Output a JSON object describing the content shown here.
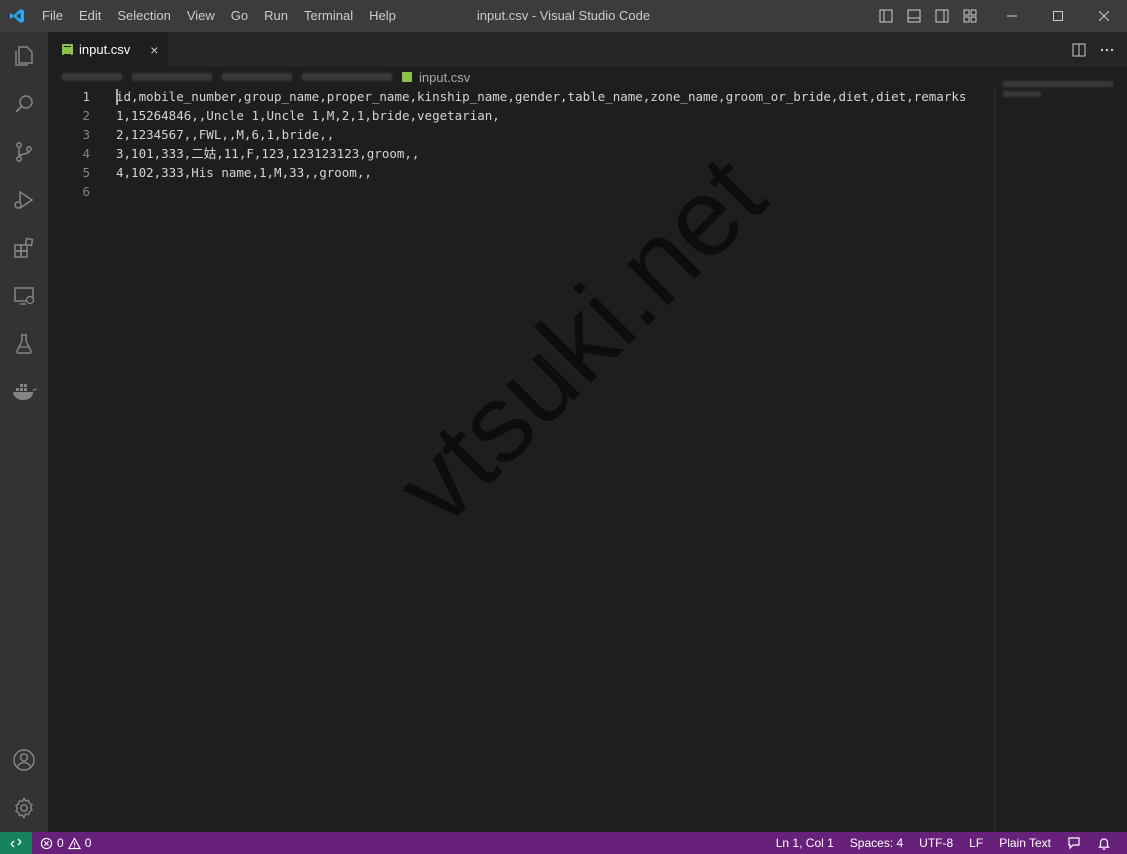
{
  "window": {
    "title": "input.csv - Visual Studio Code",
    "menu": [
      "File",
      "Edit",
      "Selection",
      "View",
      "Go",
      "Run",
      "Terminal",
      "Help"
    ]
  },
  "activity_bar": {
    "top_icons": [
      "files-icon",
      "search-icon",
      "source-control-icon",
      "run-debug-icon",
      "extensions-icon",
      "remote-explorer-icon",
      "testing-icon",
      "docker-icon"
    ],
    "bottom_icons": [
      "account-icon",
      "manage-gear-icon"
    ]
  },
  "tab": {
    "label": "input.csv",
    "close": "×"
  },
  "breadcrumb": {
    "file": "input.csv"
  },
  "editor": {
    "line_numbers": [
      "1",
      "2",
      "3",
      "4",
      "5",
      "6"
    ],
    "lines": [
      "id,mobile_number,group_name,proper_name,kinship_name,gender,table_name,zone_name,groom_or_bride,diet,diet,remarks",
      "1,15264846,,Uncle 1,Uncle 1,M,2,1,bride,vegetarian,",
      "2,1234567,,FWL,,M,6,1,bride,,",
      "3,101,333,二姑,11,F,123,123123123,groom,,",
      "4,102,333,His name,1,M,33,,groom,,",
      ""
    ]
  },
  "watermark": "vtsuki.net",
  "status": {
    "errors": "0",
    "warnings": "0",
    "position": "Ln 1, Col 1",
    "spaces": "Spaces: 4",
    "encoding": "UTF-8",
    "eol": "LF",
    "language": "Plain Text"
  },
  "colors": {
    "statusbar": "#68217a",
    "remote": "#16825d",
    "csv_icon": "#8dc149",
    "vscode_blue": "#23a9f2"
  }
}
